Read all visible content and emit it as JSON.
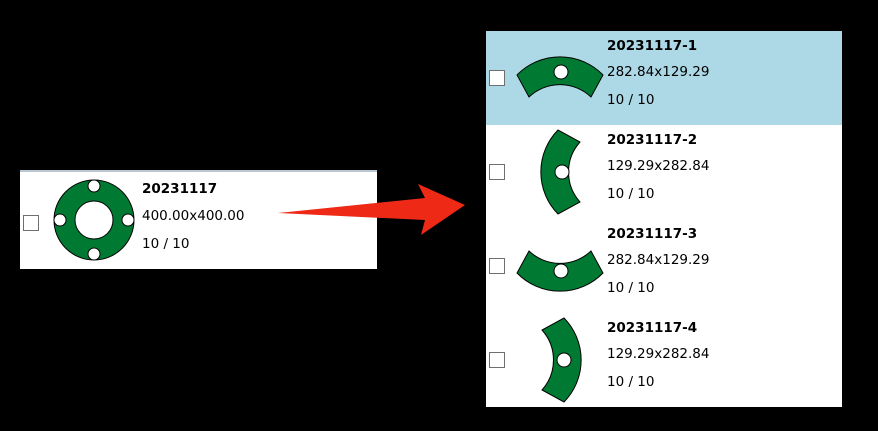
{
  "colors": {
    "part_fill": "#007a33",
    "selected_row": "#add8e6",
    "arrow": "#ee2a17",
    "background": "#000000"
  },
  "source_part": {
    "name": "20231117",
    "size": "400.00x400.00",
    "quantity": "10 / 10",
    "thumbnail": "ring-flange-icon",
    "checked": false
  },
  "split_parts": [
    {
      "name": "20231117-1",
      "size": "282.84x129.29",
      "quantity": "10 / 10",
      "thumbnail": "arc-segment-top-icon",
      "selected": true,
      "checked": false
    },
    {
      "name": "20231117-2",
      "size": "129.29x282.84",
      "quantity": "10 / 10",
      "thumbnail": "arc-segment-left-icon",
      "selected": false,
      "checked": false
    },
    {
      "name": "20231117-3",
      "size": "282.84x129.29",
      "quantity": "10 / 10",
      "thumbnail": "arc-segment-bottom-icon",
      "selected": false,
      "checked": false
    },
    {
      "name": "20231117-4",
      "size": "129.29x282.84",
      "quantity": "10 / 10",
      "thumbnail": "arc-segment-right-icon",
      "selected": false,
      "checked": false
    }
  ],
  "arrow_icon": "right-arrow-icon"
}
